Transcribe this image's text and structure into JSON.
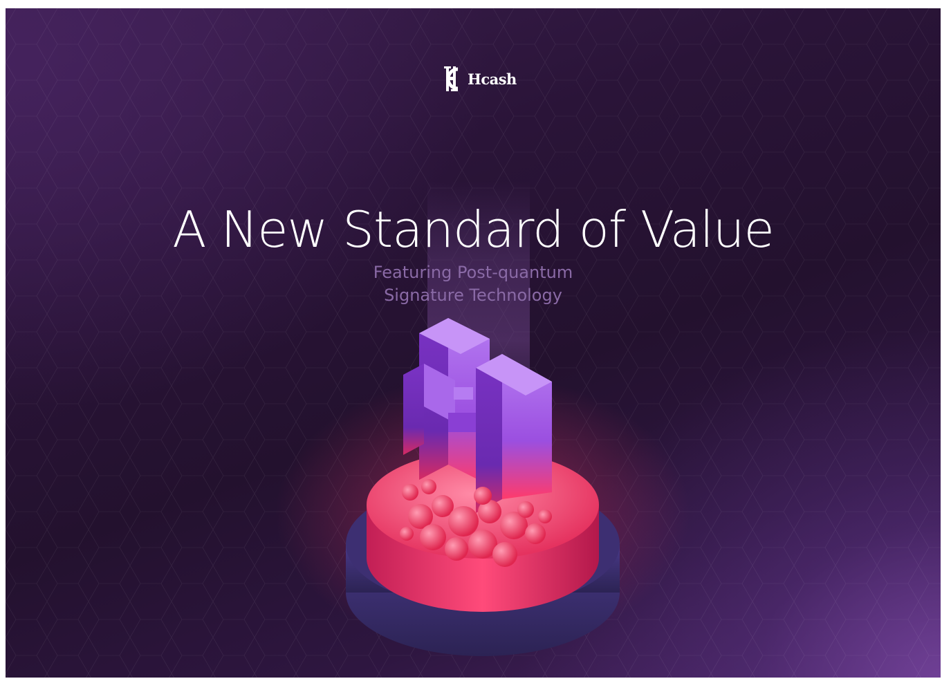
{
  "brand": {
    "name": "Hcash",
    "logo_icon": "hcash-logo-icon"
  },
  "hero": {
    "title": "A New Standard of Value",
    "subtitle_line1": "Featuring Post-quantum",
    "subtitle_line2": "Signature Technology"
  },
  "illustration": {
    "icon": "hcash-isometric-pedestal-illustration"
  },
  "colors": {
    "background": "#2a1438",
    "accent_purple": "#9b4fe0",
    "accent_red": "#ff3b6b",
    "subtitle": "#8a6aa6"
  }
}
